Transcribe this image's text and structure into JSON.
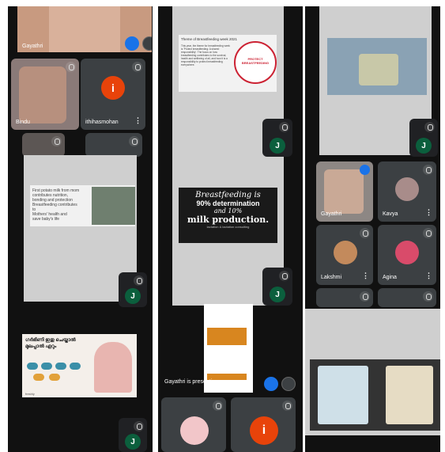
{
  "col1": {
    "top_name": "Gayathri",
    "tiles": [
      {
        "name": "Bindu",
        "kind": "video"
      },
      {
        "name": "ithihasmohan",
        "kind": "avatar",
        "letter": "i",
        "color": "#e8430a"
      }
    ],
    "slide1": {
      "lines": [
        "First potato milk from mom",
        "contributes nutrition, bonding and protection",
        "Breastfeeding contributes to",
        "Mothers' health and",
        "save baby's life"
      ]
    },
    "slide2": {
      "heading": "ഗർഭിണി ഇതു ചെയ്താൽ മുലപ്പാൽ ഏറും",
      "brand": "freshly"
    },
    "badge": "J"
  },
  "col2": {
    "slide_title": "Theme of Breastfeeding week 2021",
    "slide_body": "This year, the theme for breastfeeding week is 'Protect breastfeeding: A shared responsibility'. The focus on how breastfeeding contributes to the survival, health and wellbeing of all, and how it is a responsibility to protect breastfeeding everywhere.",
    "seal_text": "PROTECT BREASTFEEDING",
    "quote_lines": [
      "Breastfeeding is",
      "90% determination",
      "and 10%",
      "milk production."
    ],
    "quote_credit": "lactation & lactation consulting",
    "presenting": "Gayathri is presenting",
    "badge": "J",
    "bottom_tiles": [
      {
        "kind": "photo"
      },
      {
        "kind": "avatar",
        "letter": "i",
        "color": "#e8430a"
      }
    ]
  },
  "col3": {
    "badge": "J",
    "tiles": [
      {
        "name": "Gayathri",
        "kind": "video",
        "speaking": true
      },
      {
        "name": "Kavya",
        "kind": "photo"
      },
      {
        "name": "Lakshmi",
        "kind": "photo"
      },
      {
        "name": "Agina",
        "kind": "photo"
      }
    ]
  },
  "colors": {
    "avatar_orange": "#e8430a",
    "badge_green": "#0b5f3d",
    "tile_gray": "#3c4043"
  }
}
